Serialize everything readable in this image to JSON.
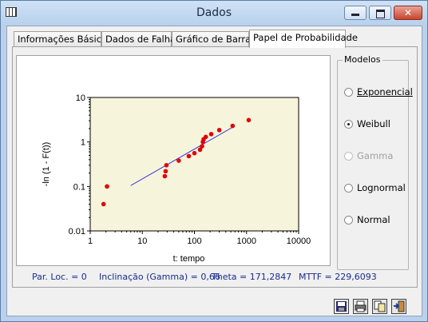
{
  "window": {
    "title": "Dados"
  },
  "tabs": [
    {
      "label": "Informações Básicas"
    },
    {
      "label": "Dados de Falha"
    },
    {
      "label": "Gráfico de Barras"
    },
    {
      "label": "Papel de Probabilidade",
      "active": true
    }
  ],
  "models": {
    "title": "Modelos",
    "options": [
      {
        "label": "Exponencial",
        "checked": false,
        "enabled": true
      },
      {
        "label": "Weibull",
        "checked": true,
        "enabled": true
      },
      {
        "label": "Gamma",
        "checked": false,
        "enabled": false
      },
      {
        "label": "Lognormal",
        "checked": false,
        "enabled": true
      },
      {
        "label": "Normal",
        "checked": false,
        "enabled": true
      }
    ]
  },
  "status": {
    "par_loc": "Par. Loc. =  0",
    "inclinacao": "Inclinação (Gamma) = 0,66",
    "theta": "Theta = 171,2847",
    "mttf": "MTTF = 229,6093"
  },
  "colors": {
    "plot_bg": "#f7f4dc",
    "points": "#e00000",
    "fit_line": "#3a3ad8",
    "status_text": "#1a2c8c"
  },
  "chart_data": {
    "type": "scatter",
    "xlabel": "t: tempo",
    "ylabel": "-ln (1 - F(t))",
    "x_scale": "log",
    "y_scale": "log",
    "xlim": [
      1,
      10000
    ],
    "ylim": [
      0.01,
      10
    ],
    "x_ticks": [
      "1",
      "10",
      "100",
      "1000",
      "10000"
    ],
    "y_ticks": [
      "10",
      "1",
      "0.1",
      "0.01"
    ],
    "points": [
      {
        "x": 1.8,
        "y": 0.04
      },
      {
        "x": 2.1,
        "y": 0.1
      },
      {
        "x": 27,
        "y": 0.17
      },
      {
        "x": 28,
        "y": 0.22
      },
      {
        "x": 29,
        "y": 0.3
      },
      {
        "x": 50,
        "y": 0.38
      },
      {
        "x": 78,
        "y": 0.48
      },
      {
        "x": 100,
        "y": 0.56
      },
      {
        "x": 128,
        "y": 0.67
      },
      {
        "x": 140,
        "y": 0.8
      },
      {
        "x": 145,
        "y": 1.0
      },
      {
        "x": 150,
        "y": 1.15
      },
      {
        "x": 165,
        "y": 1.3
      },
      {
        "x": 210,
        "y": 1.5
      },
      {
        "x": 300,
        "y": 1.85
      },
      {
        "x": 540,
        "y": 2.3
      },
      {
        "x": 1100,
        "y": 3.1
      }
    ],
    "fit_line": {
      "x": [
        6,
        600
      ],
      "y": [
        0.105,
        2.3
      ]
    }
  }
}
